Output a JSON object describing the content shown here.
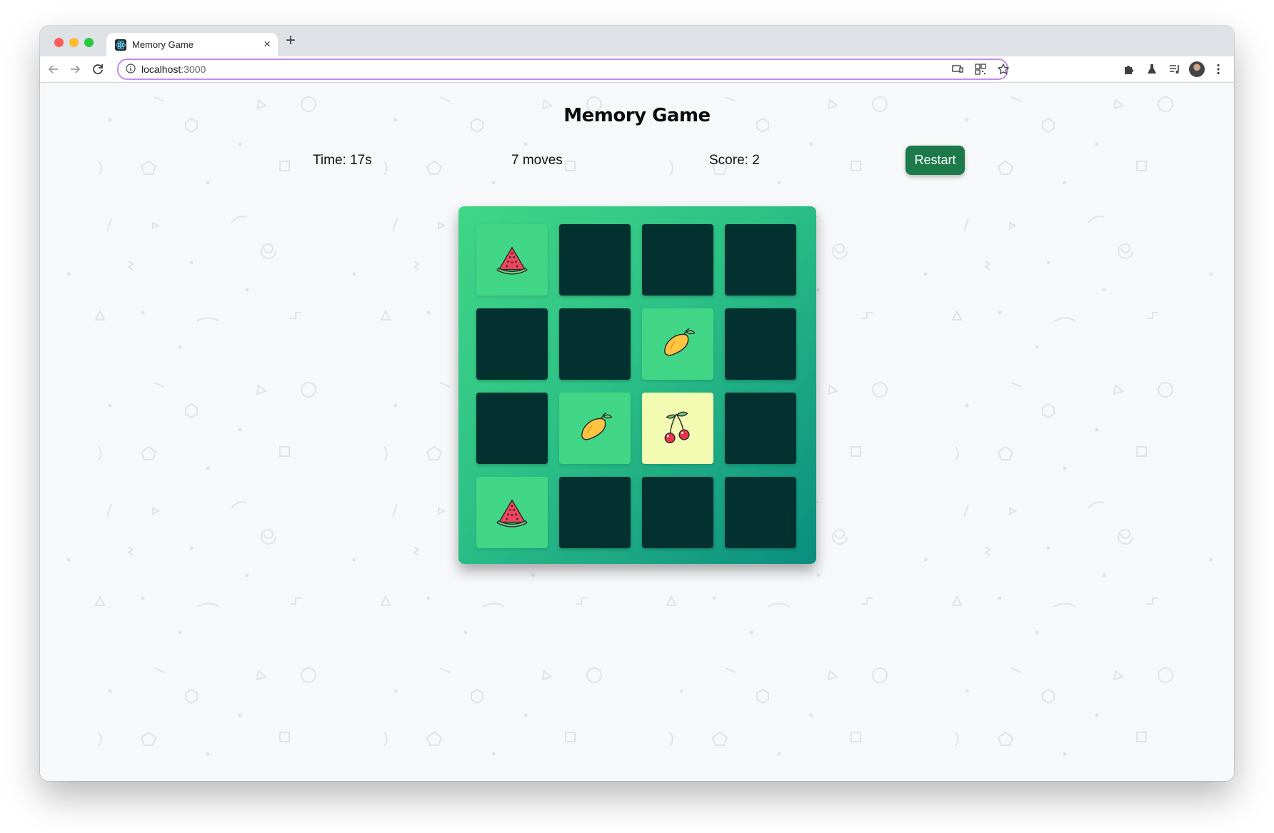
{
  "browser": {
    "tab_title": "Memory Game",
    "url_host": "localhost",
    "url_port": ":3000",
    "tab_favicon_icon": "react-logo-icon",
    "toolbar_icons": [
      "back-arrow-icon",
      "forward-arrow-icon",
      "reload-icon",
      "info-icon",
      "cast-icon",
      "qr-code-icon",
      "star-bookmark-icon",
      "extensions-puzzle-icon",
      "labs-flask-icon",
      "media-playlist-icon",
      "profile-avatar-icon",
      "more-vertical-icon"
    ]
  },
  "game": {
    "title": "Memory Game",
    "time_label": "Time: 17s",
    "moves_label": "7 moves",
    "score_label": "Score: 2",
    "restart_label": "Restart",
    "colors": {
      "board_start": "#40d685",
      "board_end": "#0a8d80",
      "card_hidden": "#023130",
      "card_matched": "#40d685",
      "card_flipped": "#f3fab1",
      "restart_button": "#1c7a4a"
    },
    "cards": [
      {
        "state": "matched",
        "fruit": "watermelon"
      },
      {
        "state": "hidden",
        "fruit": ""
      },
      {
        "state": "hidden",
        "fruit": ""
      },
      {
        "state": "hidden",
        "fruit": ""
      },
      {
        "state": "hidden",
        "fruit": ""
      },
      {
        "state": "hidden",
        "fruit": ""
      },
      {
        "state": "matched",
        "fruit": "mango"
      },
      {
        "state": "hidden",
        "fruit": ""
      },
      {
        "state": "hidden",
        "fruit": ""
      },
      {
        "state": "matched",
        "fruit": "mango"
      },
      {
        "state": "flipped",
        "fruit": "cherry"
      },
      {
        "state": "hidden",
        "fruit": ""
      },
      {
        "state": "matched",
        "fruit": "watermelon"
      },
      {
        "state": "hidden",
        "fruit": ""
      },
      {
        "state": "hidden",
        "fruit": ""
      },
      {
        "state": "hidden",
        "fruit": ""
      }
    ]
  }
}
